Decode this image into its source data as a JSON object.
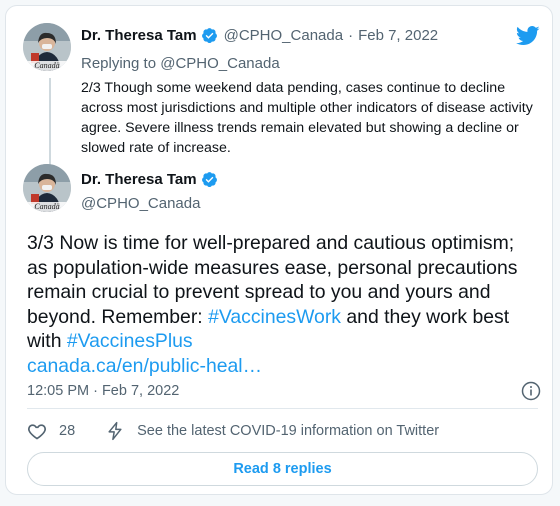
{
  "colors": {
    "accent": "#1d9bf0",
    "verified": "#1d9bf0",
    "muted": "#536471",
    "text": "#0f1419"
  },
  "icons": [
    "twitter-bird-icon",
    "verified-badge-icon",
    "info-icon",
    "heart-icon",
    "lightning-icon"
  ],
  "parent_tweet": {
    "author_name": "Dr. Theresa Tam",
    "handle": "@CPHO_Canada",
    "separator": "·",
    "date": "Feb 7, 2022",
    "replying_prefix": "Replying to",
    "replying_handle": "@CPHO_Canada",
    "text": "2/3 Though some weekend data pending, cases continue to decline across most jurisdictions and multiple other indicators of disease activity agree. Severe illness trends remain elevated but showing a decline or slowed rate of increase.",
    "avatar_caption": "Canadä"
  },
  "main_tweet": {
    "author_name": "Dr. Theresa Tam",
    "handle": "@CPHO_Canada",
    "avatar_caption": "Canadä",
    "text_part1": "3/3 Now is time for well-prepared and cautious optimism; as population-wide measures ease, personal precautions remain crucial to prevent spread to you and yours and beyond. Remember: ",
    "hashtag1": "#VaccinesWork",
    "text_part2": " and they work best with ",
    "hashtag2": "#VaccinesPlus",
    "link": "canada.ca/en/public-heal…",
    "timestamp": "12:05 PM · Feb 7, 2022"
  },
  "actions": {
    "like_count": "28",
    "covid_info": "See the latest COVID-19 information on Twitter"
  },
  "read_replies_label": "Read 8 replies"
}
